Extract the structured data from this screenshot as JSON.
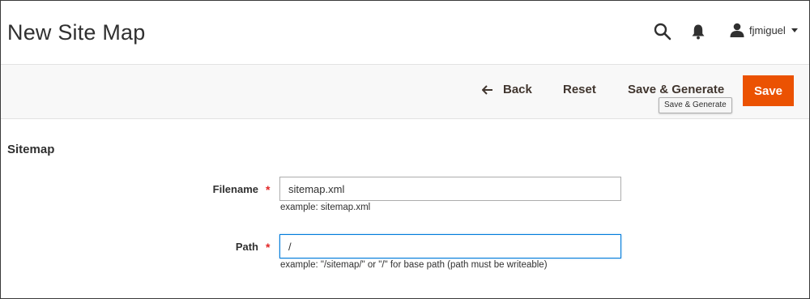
{
  "header": {
    "title": "New Site Map",
    "icons": {
      "search": "search-icon",
      "notifications": "bell-icon",
      "user": "user-icon"
    },
    "user_name": "fjmiguel"
  },
  "action_bar": {
    "back_label": "Back",
    "reset_label": "Reset",
    "save_generate_label": "Save & Generate",
    "save_label": "Save",
    "tooltip": "Save & Generate"
  },
  "form": {
    "section_title": "Sitemap",
    "fields": [
      {
        "label": "Filename",
        "required_mark": "*",
        "value": "sitemap.xml",
        "note": "example: sitemap.xml"
      },
      {
        "label": "Path",
        "required_mark": "*",
        "value": "/",
        "note": "example: \"/sitemap/\" or \"/\" for base path (path must be writeable)"
      }
    ]
  },
  "colors": {
    "primary_button": "#eb5202",
    "required_star": "#e22626",
    "focus_border": "#007bdb",
    "action_bar_bg": "#f8f8f8"
  }
}
